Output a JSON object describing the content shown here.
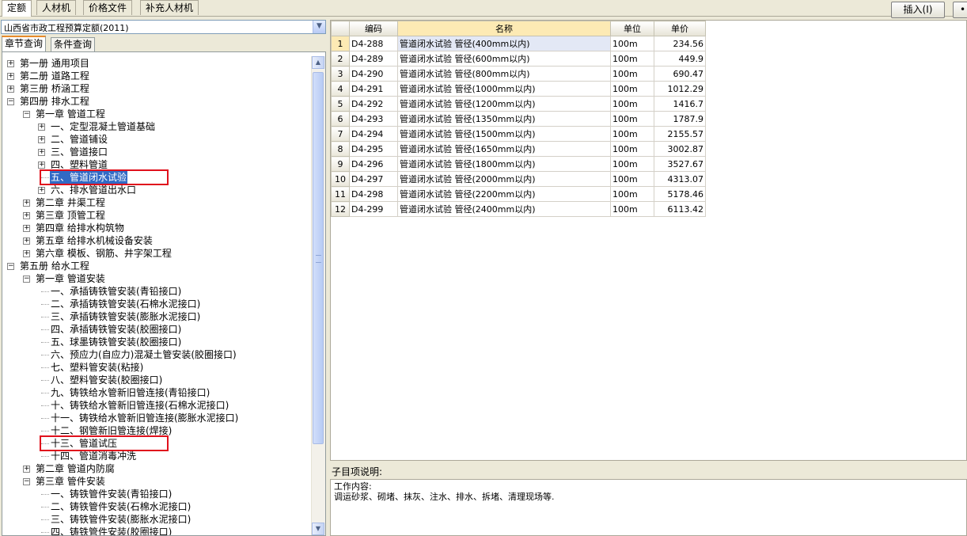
{
  "top_tabs": [
    {
      "label": "定额",
      "active": true
    },
    {
      "label": "人材机",
      "active": false
    },
    {
      "label": "价格文件",
      "active": false
    },
    {
      "label": "补充人材机",
      "active": false
    }
  ],
  "insert_button": "插入(I)",
  "library_select": "山西省市政工程预算定额(2011)",
  "left_tabs": [
    {
      "label": "章节查询",
      "active": true
    },
    {
      "label": "条件查询",
      "active": false
    }
  ],
  "tree": [
    {
      "label": "第一册 通用项目",
      "level": 0,
      "expander": "+"
    },
    {
      "label": "第二册 道路工程",
      "level": 0,
      "expander": "+"
    },
    {
      "label": "第三册 桥涵工程",
      "level": 0,
      "expander": "+"
    },
    {
      "label": "第四册 排水工程",
      "level": 0,
      "expander": "-"
    },
    {
      "label": "第一章 管道工程",
      "level": 1,
      "expander": "-"
    },
    {
      "label": "一、定型混凝土管道基础",
      "level": 2,
      "expander": "+"
    },
    {
      "label": "二、管道铺设",
      "level": 2,
      "expander": "+"
    },
    {
      "label": "三、管道接口",
      "level": 2,
      "expander": "+"
    },
    {
      "label": "四、塑料管道",
      "level": 2,
      "expander": "+"
    },
    {
      "label": "五、管道闭水试验",
      "level": 2,
      "expander": "",
      "selected": true,
      "highlight": true
    },
    {
      "label": "六、排水管道出水口",
      "level": 2,
      "expander": "+"
    },
    {
      "label": "第二章 井渠工程",
      "level": 1,
      "expander": "+"
    },
    {
      "label": "第三章 顶管工程",
      "level": 1,
      "expander": "+"
    },
    {
      "label": "第四章 给排水构筑物",
      "level": 1,
      "expander": "+"
    },
    {
      "label": "第五章 给排水机械设备安装",
      "level": 1,
      "expander": "+"
    },
    {
      "label": "第六章 模板、钢筋、井字架工程",
      "level": 1,
      "expander": "+"
    },
    {
      "label": "第五册 给水工程",
      "level": 0,
      "expander": "-"
    },
    {
      "label": "第一章 管道安装",
      "level": 1,
      "expander": "-"
    },
    {
      "label": "一、承插铸铁管安装(青铅接口)",
      "level": 2,
      "expander": ""
    },
    {
      "label": "二、承插铸铁管安装(石棉水泥接口)",
      "level": 2,
      "expander": ""
    },
    {
      "label": "三、承插铸铁管安装(膨胀水泥接口)",
      "level": 2,
      "expander": ""
    },
    {
      "label": "四、承插铸铁管安装(胶圈接口)",
      "level": 2,
      "expander": ""
    },
    {
      "label": "五、球墨铸铁管安装(胶圈接口)",
      "level": 2,
      "expander": ""
    },
    {
      "label": "六、预应力(自应力)混凝土管安装(胶圈接口)",
      "level": 2,
      "expander": ""
    },
    {
      "label": "七、塑料管安装(粘接)",
      "level": 2,
      "expander": ""
    },
    {
      "label": "八、塑料管安装(胶圈接口)",
      "level": 2,
      "expander": ""
    },
    {
      "label": "九、铸铁给水管新旧管连接(青铅接口)",
      "level": 2,
      "expander": ""
    },
    {
      "label": "十、铸铁给水管新旧管连接(石棉水泥接口)",
      "level": 2,
      "expander": ""
    },
    {
      "label": "十一、铸铁给水管新旧管连接(膨胀水泥接口)",
      "level": 2,
      "expander": ""
    },
    {
      "label": "十二、钢管新旧管连接(焊接)",
      "level": 2,
      "expander": ""
    },
    {
      "label": "十三、管道试压",
      "level": 2,
      "expander": "",
      "highlight": true
    },
    {
      "label": "十四、管道消毒冲洗",
      "level": 2,
      "expander": ""
    },
    {
      "label": "第二章 管道内防腐",
      "level": 1,
      "expander": "+"
    },
    {
      "label": "第三章 管件安装",
      "level": 1,
      "expander": "-"
    },
    {
      "label": "一、铸铁管件安装(青铅接口)",
      "level": 2,
      "expander": ""
    },
    {
      "label": "二、铸铁管件安装(石棉水泥接口)",
      "level": 2,
      "expander": ""
    },
    {
      "label": "三、铸铁管件安装(膨胀水泥接口)",
      "level": 2,
      "expander": ""
    },
    {
      "label": "四、铸铁管件安装(胶圈接口)",
      "level": 2,
      "expander": ""
    }
  ],
  "grid": {
    "headers": [
      "",
      "编码",
      "名称",
      "单位",
      "单价"
    ],
    "rows": [
      [
        "1",
        "D4-288",
        "管道闭水试验 管径(400mm以内)",
        "100m",
        "234.56"
      ],
      [
        "2",
        "D4-289",
        "管道闭水试验 管径(600mm以内)",
        "100m",
        "449.9"
      ],
      [
        "3",
        "D4-290",
        "管道闭水试验 管径(800mm以内)",
        "100m",
        "690.47"
      ],
      [
        "4",
        "D4-291",
        "管道闭水试验 管径(1000mm以内)",
        "100m",
        "1012.29"
      ],
      [
        "5",
        "D4-292",
        "管道闭水试验 管径(1200mm以内)",
        "100m",
        "1416.7"
      ],
      [
        "6",
        "D4-293",
        "管道闭水试验 管径(1350mm以内)",
        "100m",
        "1787.9"
      ],
      [
        "7",
        "D4-294",
        "管道闭水试验 管径(1500mm以内)",
        "100m",
        "2155.57"
      ],
      [
        "8",
        "D4-295",
        "管道闭水试验 管径(1650mm以内)",
        "100m",
        "3002.87"
      ],
      [
        "9",
        "D4-296",
        "管道闭水试验 管径(1800mm以内)",
        "100m",
        "3527.67"
      ],
      [
        "10",
        "D4-297",
        "管道闭水试验 管径(2000mm以内)",
        "100m",
        "4313.07"
      ],
      [
        "11",
        "D4-298",
        "管道闭水试验 管径(2200mm以内)",
        "100m",
        "5178.46"
      ],
      [
        "12",
        "D4-299",
        "管道闭水试验 管径(2400mm以内)",
        "100m",
        "6113.42"
      ]
    ]
  },
  "description": {
    "title": "子目项说明:",
    "line1": "工作内容:",
    "line2": "调运砂浆、砌堵、抹灰、注水、排水、拆堵、清理现场等."
  }
}
